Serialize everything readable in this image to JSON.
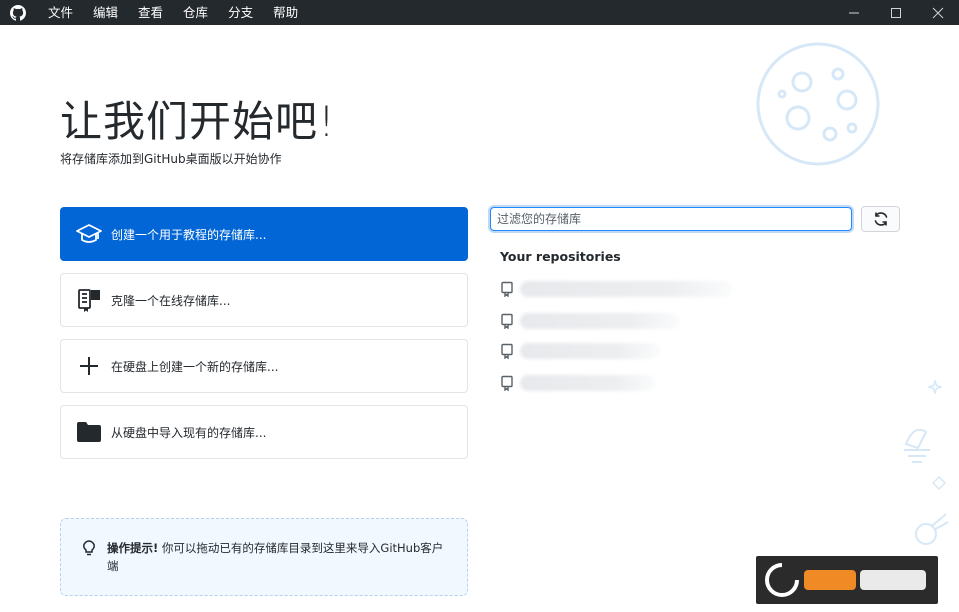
{
  "menu": {
    "items": [
      "文件",
      "编辑",
      "查看",
      "仓库",
      "分支",
      "帮助"
    ]
  },
  "hero": {
    "title": "让我们开始吧!",
    "subtitle": "将存储库添加到GitHub桌面版以开始协作"
  },
  "actions": [
    {
      "label": "创建一个用于教程的存储库...",
      "icon": "mortarboard-icon",
      "primary": true
    },
    {
      "label": "克隆一个在线存储库...",
      "icon": "repo-clone-icon",
      "primary": false
    },
    {
      "label": "在硬盘上创建一个新的存储库...",
      "icon": "plus-icon",
      "primary": false
    },
    {
      "label": "从硬盘中导入现有的存储库...",
      "icon": "folder-icon",
      "primary": false
    }
  ],
  "tip": {
    "label": "操作提示!",
    "text": " 你可以拖动已有的存储库目录到这里来导入GitHub客户端"
  },
  "repositories": {
    "filter_placeholder": "过滤您的存储库",
    "filter_value": "",
    "heading": "Your repositories",
    "count": 4
  },
  "colors": {
    "titlebar": "#24292e",
    "primary": "#0366d6",
    "tip_bg": "#f1f8ff",
    "tip_border": "#b6d2ee"
  }
}
